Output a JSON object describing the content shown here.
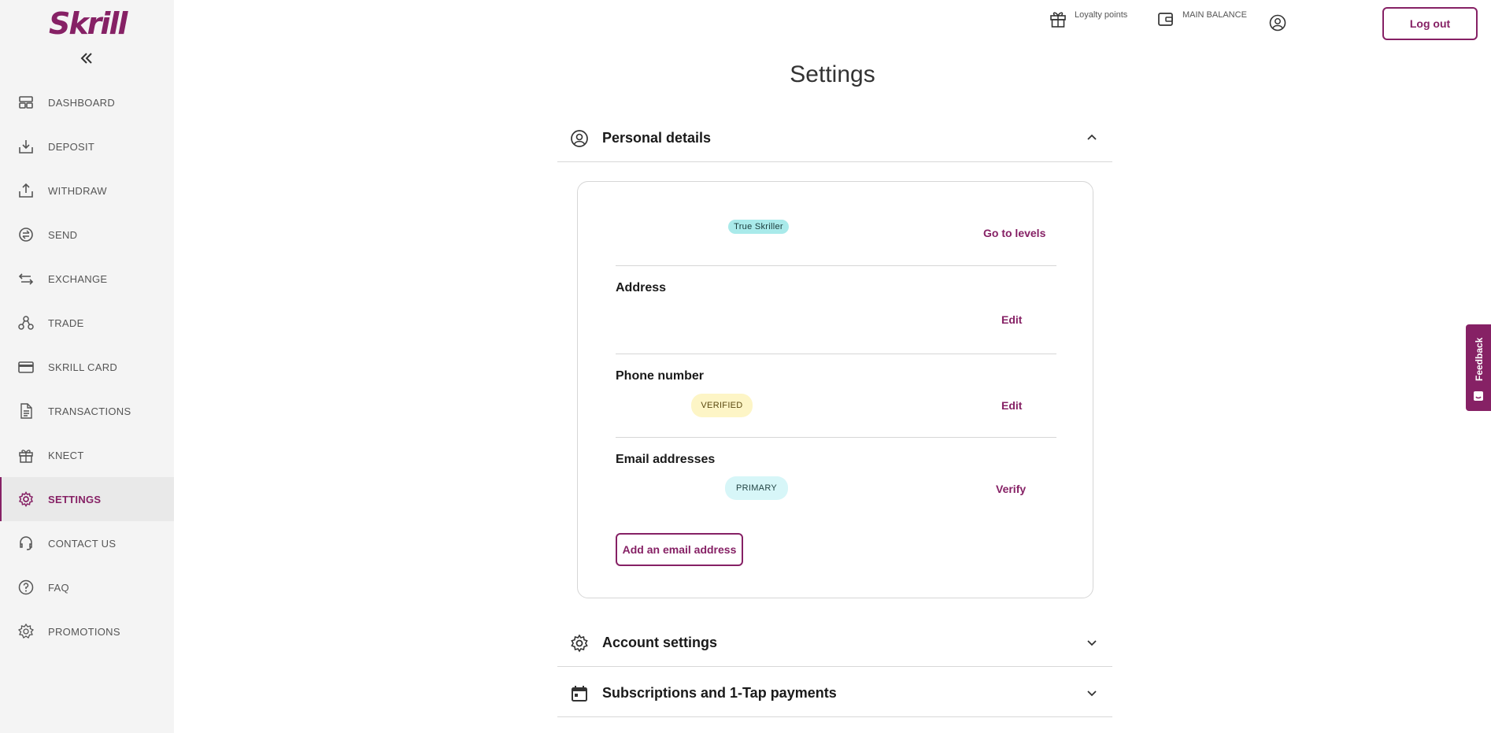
{
  "app": {
    "brand": "Skrill",
    "accent": "#862165"
  },
  "sidebar": {
    "items": [
      {
        "label": "DASHBOARD",
        "icon": "dashboard-icon",
        "active": false
      },
      {
        "label": "DEPOSIT",
        "icon": "deposit-icon",
        "active": false
      },
      {
        "label": "WITHDRAW",
        "icon": "withdraw-icon",
        "active": false
      },
      {
        "label": "SEND",
        "icon": "send-icon",
        "active": false
      },
      {
        "label": "EXCHANGE",
        "icon": "exchange-icon",
        "active": false
      },
      {
        "label": "TRADE",
        "icon": "trade-icon",
        "active": false
      },
      {
        "label": "SKRILL CARD",
        "icon": "card-icon",
        "active": false
      },
      {
        "label": "TRANSACTIONS",
        "icon": "document-icon",
        "active": false
      },
      {
        "label": "KNECT",
        "icon": "gift-icon",
        "active": false
      },
      {
        "label": "SETTINGS",
        "icon": "gear-icon",
        "active": true
      },
      {
        "label": "CONTACT US",
        "icon": "headset-icon",
        "active": false
      },
      {
        "label": "FAQ",
        "icon": "question-icon",
        "active": false
      },
      {
        "label": "PROMOTIONS",
        "icon": "promo-badge-icon",
        "active": false
      }
    ]
  },
  "header": {
    "loyalty_label": "Loyalty points",
    "balance_label": "MAIN BALANCE",
    "logout_label": "Log out"
  },
  "page": {
    "title": "Settings"
  },
  "personal_details": {
    "title": "Personal details",
    "level_badge": "True Skriller",
    "go_to_levels": "Go to levels",
    "address_title": "Address",
    "address_edit": "Edit",
    "phone_title": "Phone number",
    "phone_badge": "VERIFIED",
    "phone_edit": "Edit",
    "email_title": "Email addresses",
    "email_badge": "PRIMARY",
    "email_verify": "Verify",
    "add_email": "Add an email address"
  },
  "sections": {
    "account_settings": "Account settings",
    "subscriptions": "Subscriptions and 1-Tap payments"
  },
  "feedback": {
    "label": "Feedback"
  }
}
